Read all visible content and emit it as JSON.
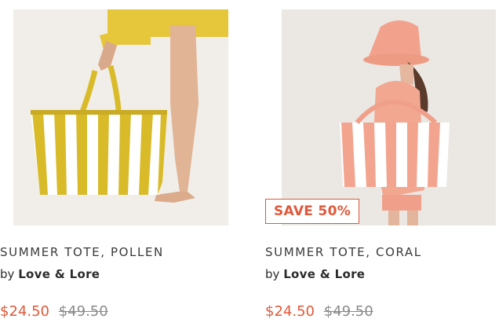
{
  "products": [
    {
      "title": "SUMMER TOTE, POLLEN",
      "by": "by",
      "vendor": "Love & Lore",
      "sale_price": "$24.50",
      "compare_price": "$49.50",
      "badge": "",
      "image_description_icon": "yellow-striped-tote-photo"
    },
    {
      "title": "SUMMER TOTE, CORAL",
      "by": "by",
      "vendor": "Love & Lore",
      "sale_price": "$24.50",
      "compare_price": "$49.50",
      "badge": "SAVE 50%",
      "image_description_icon": "coral-striped-tote-photo"
    }
  ],
  "colors": {
    "accent_sale": "#e0593a",
    "compare_price": "#8a8a8a",
    "pollen_yellow": "#d9bb2a",
    "coral": "#f0a08a"
  }
}
